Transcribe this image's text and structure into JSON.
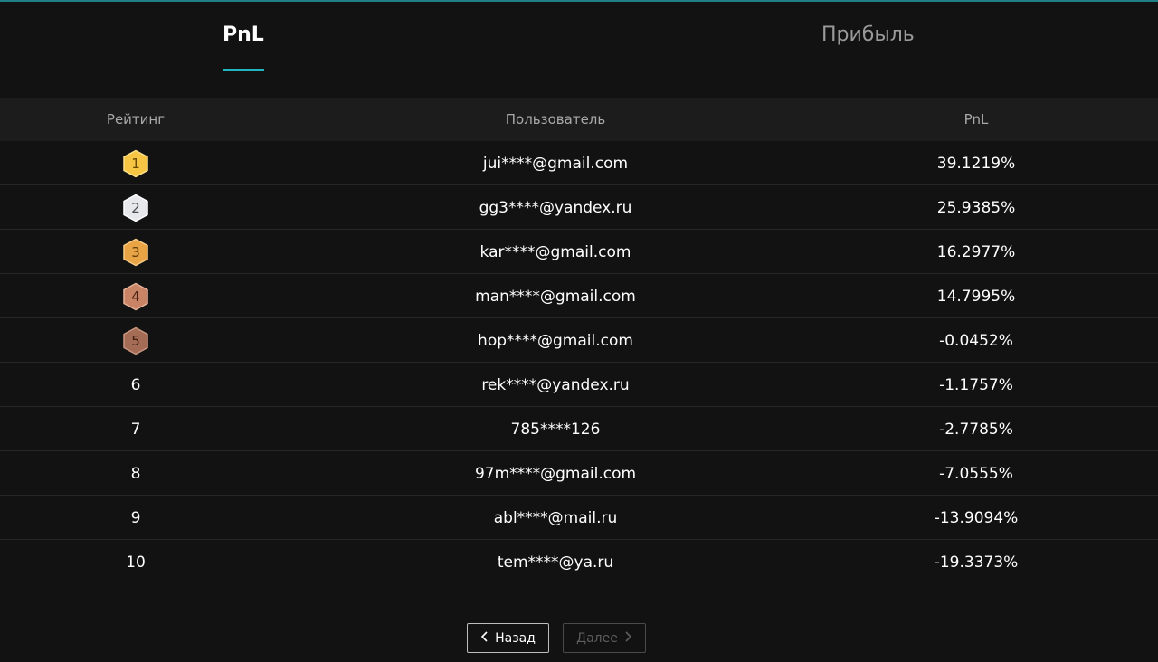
{
  "tabs": [
    {
      "label": "PnL",
      "active": true
    },
    {
      "label": "Прибыль",
      "active": false
    }
  ],
  "table": {
    "headers": {
      "rank": "Рейтинг",
      "user": "Пользователь",
      "pnl": "PnL"
    },
    "rows": [
      {
        "rank": "1",
        "user": "jui****@gmail.com",
        "pnl": "39.1219%"
      },
      {
        "rank": "2",
        "user": "gg3****@yandex.ru",
        "pnl": "25.9385%"
      },
      {
        "rank": "3",
        "user": "kar****@gmail.com",
        "pnl": "16.2977%"
      },
      {
        "rank": "4",
        "user": "man****@gmail.com",
        "pnl": "14.7995%"
      },
      {
        "rank": "5",
        "user": "hop****@gmail.com",
        "pnl": "-0.0452%"
      },
      {
        "rank": "6",
        "user": "rek****@yandex.ru",
        "pnl": "-1.1757%"
      },
      {
        "rank": "7",
        "user": "785****126",
        "pnl": "-2.7785%"
      },
      {
        "rank": "8",
        "user": "97m****@gmail.com",
        "pnl": "-7.0555%"
      },
      {
        "rank": "9",
        "user": "abl****@mail.ru",
        "pnl": "-13.9094%"
      },
      {
        "rank": "10",
        "user": "tem****@ya.ru",
        "pnl": "-19.3373%"
      }
    ]
  },
  "badges": [
    {
      "icon": "gold-medal-hexagon-icon",
      "fill": "#f6c544",
      "stroke": "#fbe08a",
      "text": "#6b4a00"
    },
    {
      "icon": "silver-medal-hexagon-icon",
      "fill": "#e6e8ec",
      "stroke": "#ffffff",
      "text": "#4a4d55"
    },
    {
      "icon": "bronze-gold-medal-hexagon-icon",
      "fill": "#e9a446",
      "stroke": "#f7cc85",
      "text": "#5e3a08"
    },
    {
      "icon": "copper-medal-hexagon-icon",
      "fill": "#c98466",
      "stroke": "#e6b29a",
      "text": "#4a2415"
    },
    {
      "icon": "dark-copper-medal-hexagon-icon",
      "fill": "#a56c55",
      "stroke": "#c99580",
      "text": "#3a1c10"
    }
  ],
  "pagination": {
    "prev_label": "Назад",
    "next_label": "Далее",
    "prev_icon": "chevron-left-icon",
    "next_icon": "chevron-right-icon"
  },
  "colors": {
    "background": "#121212",
    "accent": "#1fb5be",
    "header_bg": "#1c1c1c"
  }
}
